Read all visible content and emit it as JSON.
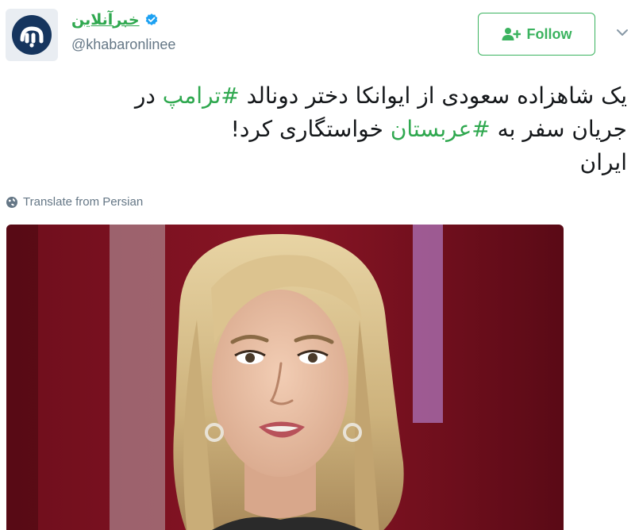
{
  "tweet": {
    "display_name": "خبرآنلاین",
    "handle": "@khabaronlinee",
    "follow_label": "Follow",
    "text_line1_part1": "یک شاهزاده سعودی از ایوانکا دختر دونالد ",
    "text_line1_hashtag": "#ترامپ",
    "text_line1_part2": " در",
    "text_line2_part1": "جریان سفر به ",
    "text_line2_hashtag": "#عربستان",
    "text_line2_part2": " خواستگاری کرد!",
    "text_line3": "ایران",
    "translate_label": "Translate from Persian"
  },
  "icons": {
    "verified": "verified-badge-icon",
    "follow": "user-plus-icon",
    "menu": "chevron-down-icon",
    "translate": "globe-icon"
  },
  "colors": {
    "accent": "#2fa84f",
    "follow_border": "#3bb35f",
    "verified": "#1da1f2",
    "secondary_text": "#657786",
    "avatar_bg": "#16355e"
  }
}
